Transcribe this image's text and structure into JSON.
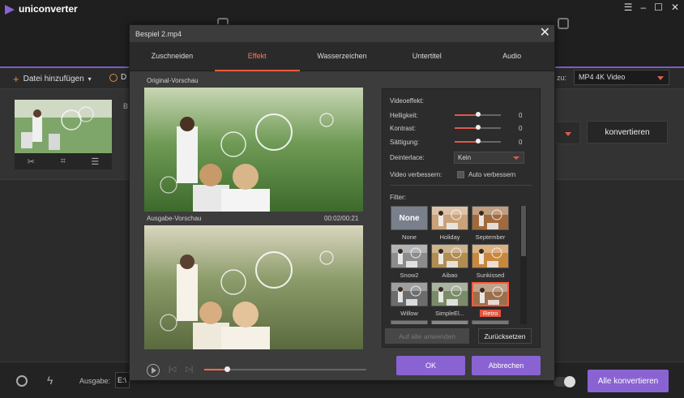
{
  "app": {
    "title": "uniconverter",
    "accent": "#8a63d2",
    "window_controls": [
      "☰",
      "–",
      "☐",
      "✕"
    ]
  },
  "toolbar": {
    "add_file": "Datei hinzufügen",
    "add_dvd": "D",
    "convert_to": "zu:",
    "format": "MP4 4K Video"
  },
  "file_item": {
    "partial_label": "B",
    "convert_label": "konvertieren"
  },
  "bottom_bar": {
    "output_label": "Ausgabe:",
    "output_path": "E:\\",
    "convert_all": "Alle konvertieren"
  },
  "dialog": {
    "title": "Bespiel 2.mp4",
    "close_icon": "✕",
    "tabs": [
      {
        "label": "Zuschneiden"
      },
      {
        "label": "Effekt"
      },
      {
        "label": "Wasserzeichen"
      },
      {
        "label": "Untertitel"
      },
      {
        "label": "Audio"
      }
    ],
    "active_tab": "Effekt",
    "original_preview_label": "Original-Vorschau",
    "output_preview_label": "Ausgabe-Vorschau",
    "output_time": "00:02/00:21",
    "playback_progress": 0.14,
    "effects_panel": {
      "title": "Videoeffekt:",
      "brightness": {
        "label": "Helligkeit:",
        "value": "0",
        "level": 0.5
      },
      "contrast": {
        "label": "Kontrast:",
        "value": "0",
        "level": 0.5
      },
      "saturation": {
        "label": "Sättigung:",
        "value": "0",
        "level": 0.5
      },
      "deinterlace": {
        "label": "Deinterlace:",
        "value": "Kein"
      },
      "enhance": {
        "label": "Video verbessern:",
        "checkbox_label": "Auto verbessern",
        "checked": false
      },
      "filter_title": "Filter:",
      "filters": [
        {
          "label": "None",
          "tone": "#7a7f8c"
        },
        {
          "label": "Holiday",
          "tone": "#c9a27a"
        },
        {
          "label": "September",
          "tone": "#a06a3c"
        },
        {
          "label": "Snow2",
          "tone": "#8c8c8c"
        },
        {
          "label": "Aibao",
          "tone": "#b08d52"
        },
        {
          "label": "Sunkissed",
          "tone": "#c7883e"
        },
        {
          "label": "Willow",
          "tone": "#6c6c6c"
        },
        {
          "label": "SimpleEl...",
          "tone": "#7b8b6a"
        },
        {
          "label": "Retro",
          "tone": "#9c6f4c"
        }
      ],
      "selected_filter": "Retro",
      "none_swatch_text": "None",
      "apply_all": "Auf alle anwenden",
      "reset": "Zurücksetzen"
    },
    "ok": "OK",
    "cancel": "Abbrechen"
  }
}
